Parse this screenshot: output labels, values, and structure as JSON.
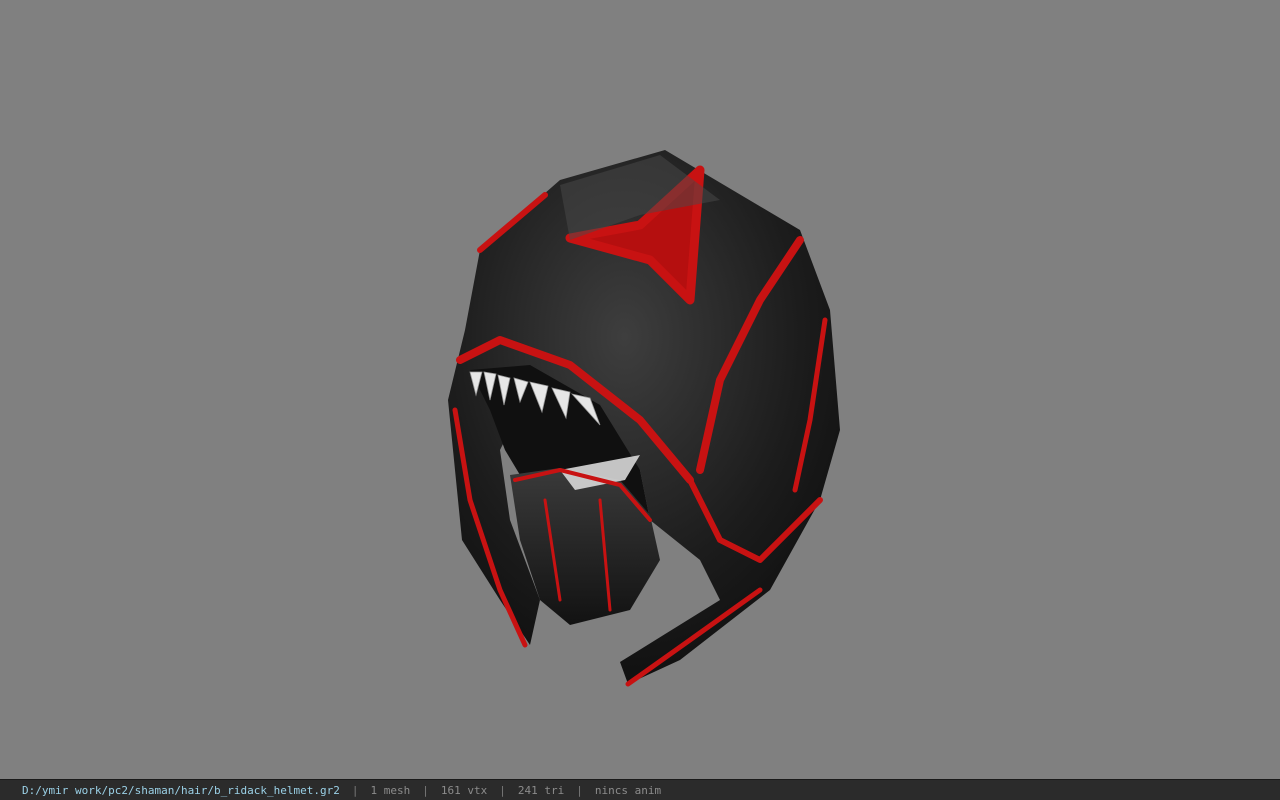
{
  "viewport": {
    "background": "#808080",
    "model_icon": "red-black-hooded-helmet"
  },
  "statusbar": {
    "file_path": "D:/ymir work/pc2/shaman/hair/b_ridack_helmet.gr2",
    "separator": "|",
    "mesh": "1 mesh",
    "vertices": "161 vtx",
    "triangles": "241 tri",
    "anim": "nincs anim",
    "path_color": "#9ad0e6"
  }
}
